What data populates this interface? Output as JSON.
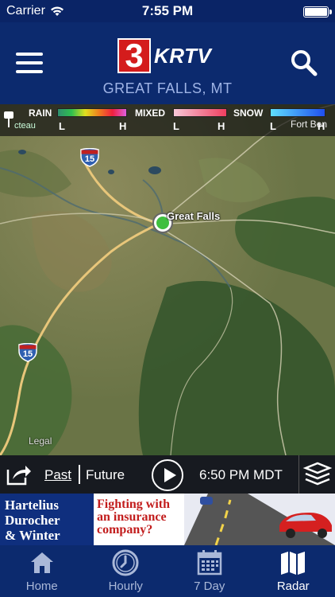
{
  "status_bar": {
    "carrier": "Carrier",
    "time": "7:55 PM"
  },
  "header": {
    "logo_number": "3",
    "logo_name": "KRTV",
    "location": "GREAT FALLS, MT",
    "menu_icon": "hamburger-icon",
    "search_icon": "search-icon"
  },
  "legend": {
    "rain_label": "RAIN",
    "mixed_label": "MIXED",
    "snow_label": "SNOW",
    "low": "L",
    "high": "H",
    "colors": {
      "rain": [
        "#2f8f6f",
        "#2fbf4f",
        "#dfdf1f",
        "#ef7f1f",
        "#ef1f3f",
        "#df5fdf"
      ],
      "mixed": [
        "#f7c7d7",
        "#ef3f5f"
      ],
      "snow": [
        "#5fdfff",
        "#1f4fef"
      ]
    }
  },
  "map": {
    "city_label": "Great Falls",
    "highway_1": "15",
    "highway_2": "15",
    "edge_label_left": "cteau",
    "edge_label_right": "Fort Ben",
    "legal_label": "Legal"
  },
  "playback": {
    "past_label": "Past",
    "future_label": "Future",
    "time": "6:50 PM MDT"
  },
  "ad": {
    "left_text": [
      "Hartelius",
      "Durocher",
      "& Winter"
    ],
    "mid_text": [
      "Fighting with",
      "an insurance",
      "company?"
    ]
  },
  "tabs": [
    {
      "label": "Home",
      "icon": "home-icon"
    },
    {
      "label": "Hourly",
      "icon": "clock-icon"
    },
    {
      "label": "7 Day",
      "icon": "calendar-icon"
    },
    {
      "label": "Radar",
      "icon": "map-icon"
    }
  ],
  "active_tab": "Radar",
  "colors": {
    "brand_navy": "#0c2a6e",
    "logo_red": "#d41c1c",
    "location_text": "#9fb4e6"
  }
}
